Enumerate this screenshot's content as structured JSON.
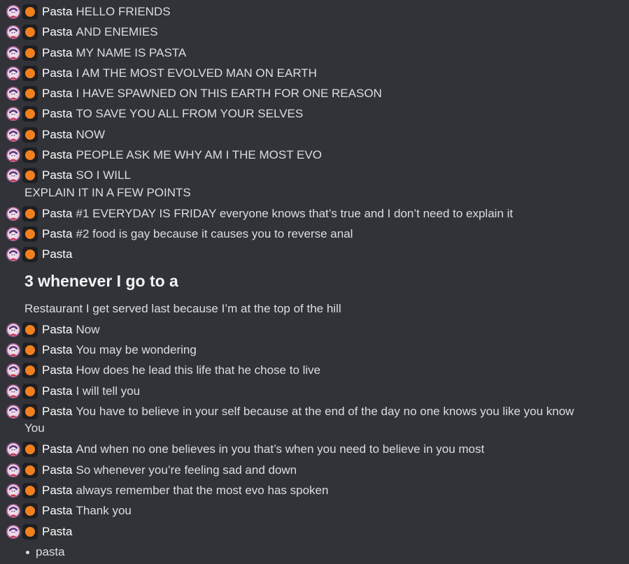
{
  "author": "Pasta",
  "messages": [
    {
      "text": "HELLO FRIENDS"
    },
    {
      "text": "AND ENEMIES"
    },
    {
      "text": "MY NAME IS PASTA"
    },
    {
      "text": "I AM THE MOST EVOLVED MAN ON EARTH"
    },
    {
      "text": "I HAVE SPAWNED ON THIS EARTH FOR ONE REASON"
    },
    {
      "text": "TO SAVE YOU ALL FROM  YOUR SELVES"
    },
    {
      "text": "NOW"
    },
    {
      "text": "PEOPLE ASK ME WHY AM I THE MOST EVO"
    },
    {
      "text": "SO I WILL",
      "continuation": "EXPLAIN IT IN A FEW POINTS"
    },
    {
      "text": "#1 EVERYDAY IS FRIDAY everyone knows that’s true and I don’t need to explain it"
    },
    {
      "text": "#2 food is gay because it causes you to reverse  anal"
    },
    {
      "text": "",
      "heading": "3 whenever I go to a",
      "continuation": "Restaurant I get served last because I’m at the top of the hill"
    },
    {
      "text": "Now"
    },
    {
      "text": "You may be wondering"
    },
    {
      "text": "How does he lead this life that he chose to live"
    },
    {
      "text": "I will tell you"
    },
    {
      "text": "You have to believe in your self because at the end of the day no one knows you like you know",
      "continuation": "You"
    },
    {
      "text": "And when no one believes in you that’s when you need to believe in you most"
    },
    {
      "text": "So whenever you’re feeling sad and down"
    },
    {
      "text": "always remember that the most evo has spoken"
    },
    {
      "text": "Thank you"
    },
    {
      "text": "",
      "bullet": "pasta"
    }
  ],
  "icons": {
    "avatar": "avatar-icon",
    "role": "orange-role-icon"
  },
  "colors": {
    "background": "#313338",
    "text": "#dbdee1",
    "name": "#ffffff",
    "role_dot": "#f2801f"
  }
}
